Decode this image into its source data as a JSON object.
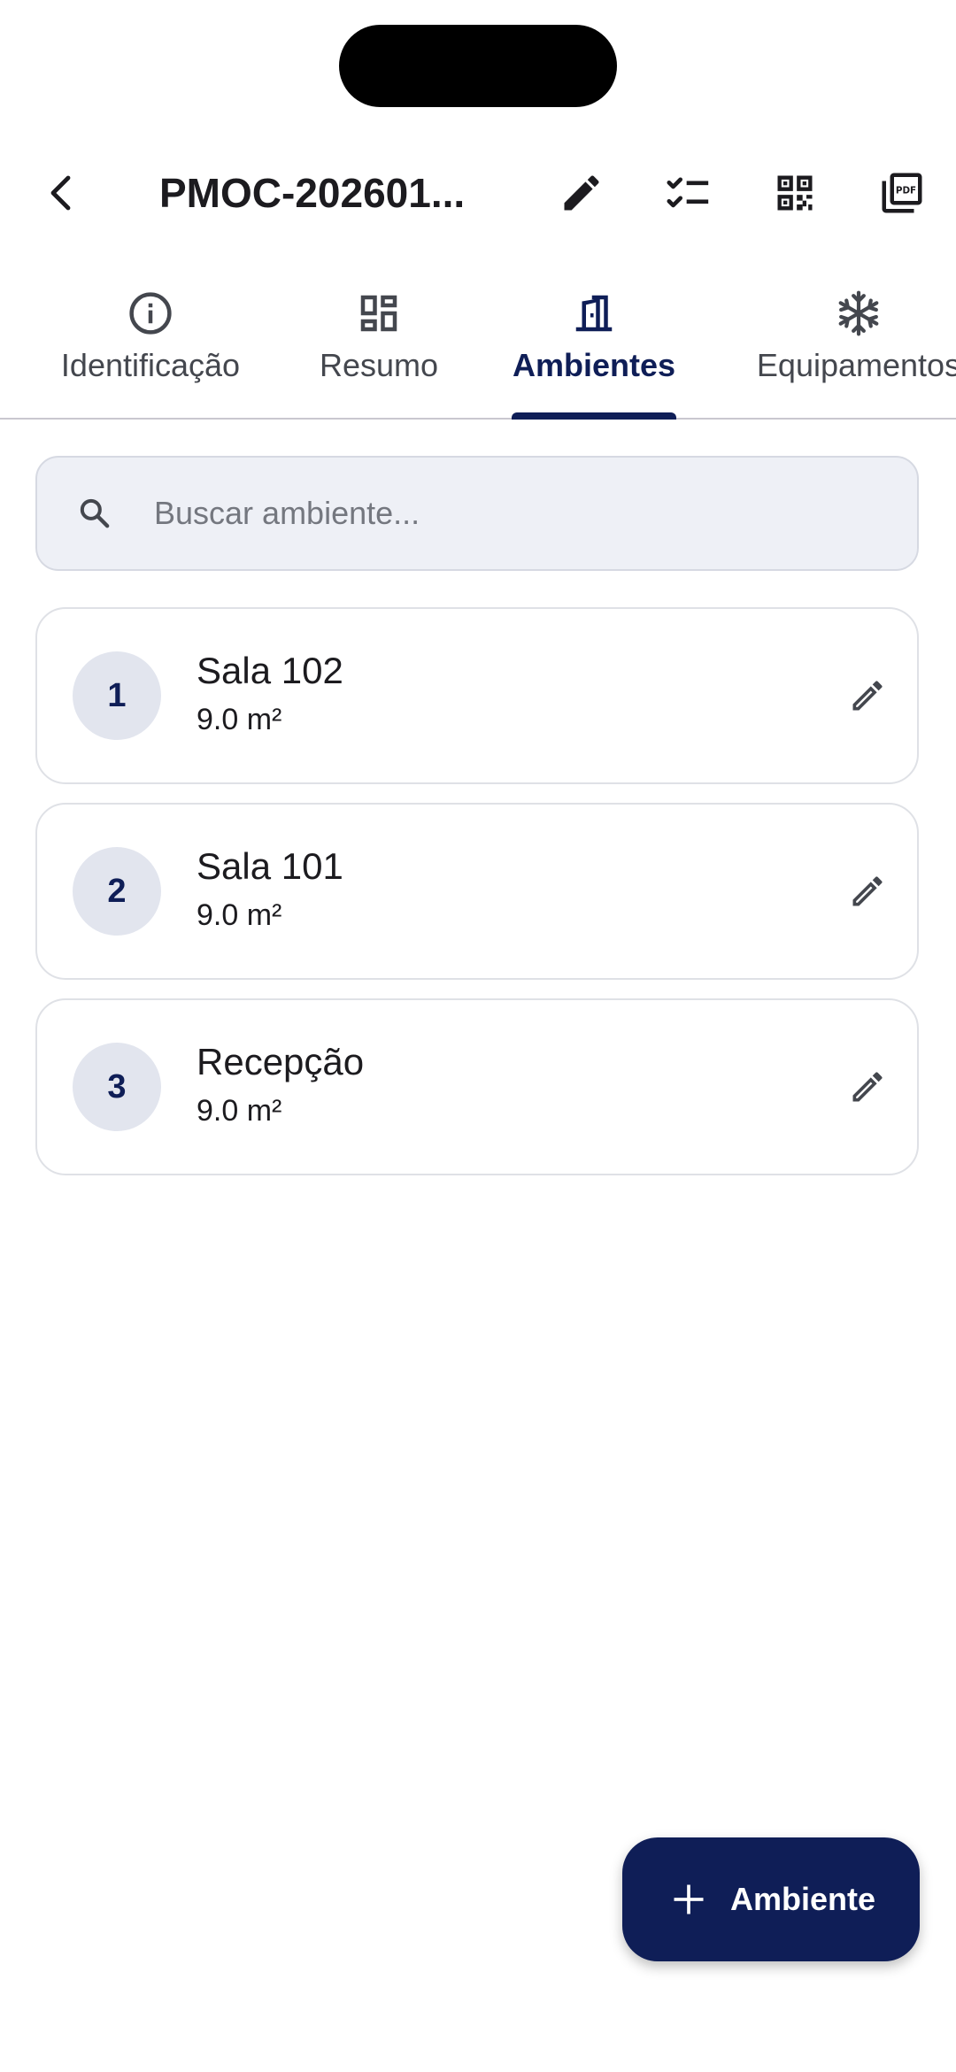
{
  "app_bar": {
    "title": "PMOC-202601...",
    "icons": {
      "back": "arrow-back-icon",
      "edit": "pencil-icon",
      "checklist": "checklist-icon",
      "qr": "qr-code-icon",
      "pdf": "pdf-icon"
    }
  },
  "tabs": [
    {
      "label": "Identificação",
      "icon": "info-icon",
      "active": false
    },
    {
      "label": "Resumo",
      "icon": "dashboard-icon",
      "active": false
    },
    {
      "label": "Ambientes",
      "icon": "door-icon",
      "active": true
    },
    {
      "label": "Equipamentos",
      "icon": "snowflake-icon",
      "active": false
    }
  ],
  "search": {
    "placeholder": "Buscar ambiente...",
    "value": ""
  },
  "rooms": [
    {
      "index": "1",
      "name": "Sala 102",
      "area": "9.0 m²"
    },
    {
      "index": "2",
      "name": "Sala 101",
      "area": "9.0 m²"
    },
    {
      "index": "3",
      "name": "Recepção",
      "area": "9.0 m²"
    }
  ],
  "fab": {
    "label": "Ambiente",
    "icon": "plus-icon"
  },
  "colors": {
    "primary": "#0f1e57",
    "surface": "#ffffff",
    "search_bg": "#eef0f6",
    "badge_bg": "#e2e5ee",
    "divider": "#c9c7cf"
  }
}
